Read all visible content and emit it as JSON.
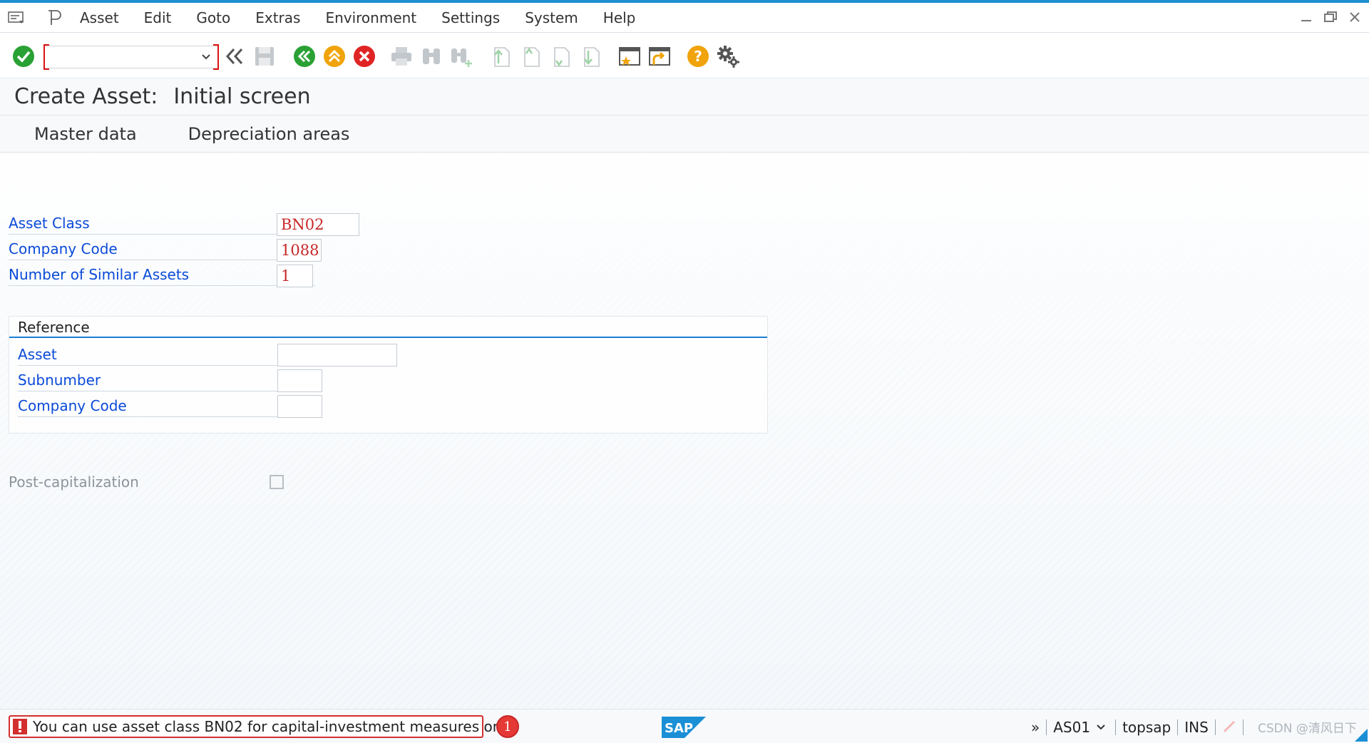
{
  "menu": {
    "items": [
      "Asset",
      "Edit",
      "Goto",
      "Extras",
      "Environment",
      "Settings",
      "System",
      "Help"
    ]
  },
  "toolbar": {
    "command_value": "",
    "icons": [
      "enter-icon",
      "back-double-chevron-icon",
      "save-icon",
      "back-icon",
      "exit-icon",
      "cancel-icon",
      "print-icon",
      "find-icon",
      "find-next-icon",
      "first-page-icon",
      "previous-page-icon",
      "next-page-icon",
      "last-page-icon",
      "create-session-icon",
      "create-shortcut-icon",
      "help-icon",
      "customize-layout-icon"
    ]
  },
  "title": {
    "part1": "Create Asset:",
    "part2": "Initial screen"
  },
  "app_toolbar": {
    "master_data": "Master data",
    "depreciation_areas": "Depreciation areas"
  },
  "form": {
    "asset_class": {
      "label": "Asset Class",
      "value": "BN02"
    },
    "company_code": {
      "label": "Company Code",
      "value": "1088"
    },
    "similar_assets": {
      "label": "Number of Similar Assets",
      "value": "1"
    }
  },
  "reference": {
    "title": "Reference",
    "asset": {
      "label": "Asset",
      "value": ""
    },
    "subnumber": {
      "label": "Subnumber",
      "value": ""
    },
    "company_code": {
      "label": "Company Code",
      "value": ""
    }
  },
  "post_capitalization": {
    "label": "Post-capitalization",
    "checked": false
  },
  "status": {
    "message": "You can use asset class BN02 for capital-investment measures only",
    "badge": "1",
    "transaction": "AS01",
    "system": "topsap",
    "mode": "INS",
    "more": "»",
    "watermark": "CSDN @清风日下"
  },
  "colors": {
    "accent": "#1d8fd1",
    "label_blue": "#0a4ad8",
    "error_red": "#d32f2f",
    "ok_green": "#2aa135",
    "orange": "#f0a30a"
  }
}
